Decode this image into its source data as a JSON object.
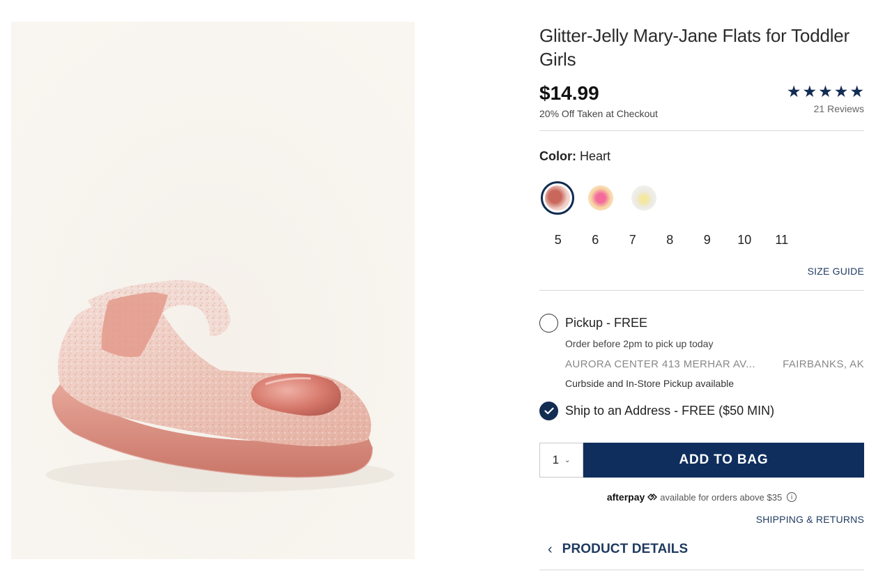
{
  "product": {
    "title": "Glitter-Jelly Mary-Jane Flats for Toddler Girls",
    "price": "$14.99",
    "discount_note": "20% Off Taken at Checkout",
    "rating": {
      "stars_filled": 5,
      "stars_total": 5,
      "reviews": "21 Reviews"
    }
  },
  "color": {
    "label": "Color:",
    "selected": "Heart",
    "swatches": [
      "heart",
      "rainbow",
      "daisy"
    ]
  },
  "sizes": [
    "5",
    "6",
    "7",
    "8",
    "9",
    "10",
    "11"
  ],
  "size_guide": "SIZE GUIDE",
  "fulfillment": {
    "pickup": {
      "label": "Pickup - FREE",
      "note": "Order before 2pm to pick up today",
      "store": "AURORA CENTER 413 MERHAR AV...",
      "city": "FAIRBANKS, AK",
      "curbside": "Curbside and In-Store Pickup available",
      "selected": false
    },
    "ship": {
      "label": "Ship to an Address - FREE ($50 MIN)",
      "selected": true
    }
  },
  "cart": {
    "quantity": "1",
    "add_label": "ADD TO BAG"
  },
  "afterpay": {
    "logo": "afterpay",
    "text": "available for orders above $35"
  },
  "shipping_returns": "SHIPPING & RETURNS",
  "product_details": "PRODUCT DETAILS",
  "colors": {
    "navy": "#0f2e5e",
    "star": "#122c52"
  }
}
